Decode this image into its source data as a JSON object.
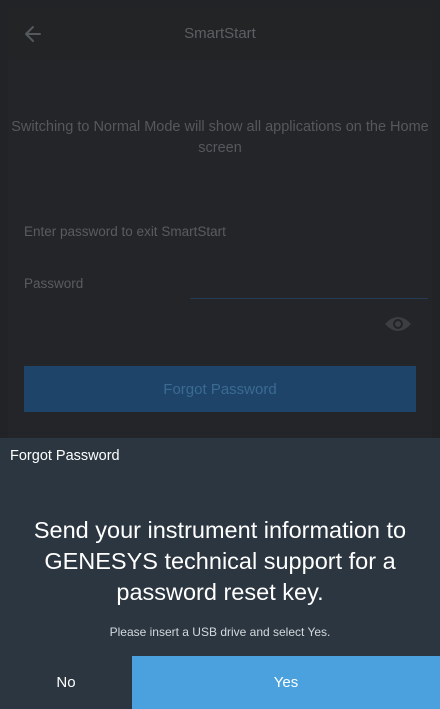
{
  "header": {
    "title": "SmartStart",
    "back_icon": "arrow-left-icon"
  },
  "main": {
    "notice": "Switching to Normal Mode will show all applications on the Home screen",
    "password_prompt": "Enter password to exit SmartStart",
    "password_label": "Password",
    "password_value": "",
    "show_password_icon": "eye-icon",
    "forgot_button_label": "Forgot Password"
  },
  "dialog": {
    "title": "Forgot Password",
    "headline": "Send your instrument information to GENESYS technical support for a password reset key.",
    "note": "Please insert a USB drive and select Yes.",
    "no_label": "No",
    "yes_label": "Yes"
  },
  "colors": {
    "background": "#222326",
    "dialog_background": "#2b3640",
    "primary_button": "#4aa1de",
    "dimmed_button": "#1e4569"
  }
}
